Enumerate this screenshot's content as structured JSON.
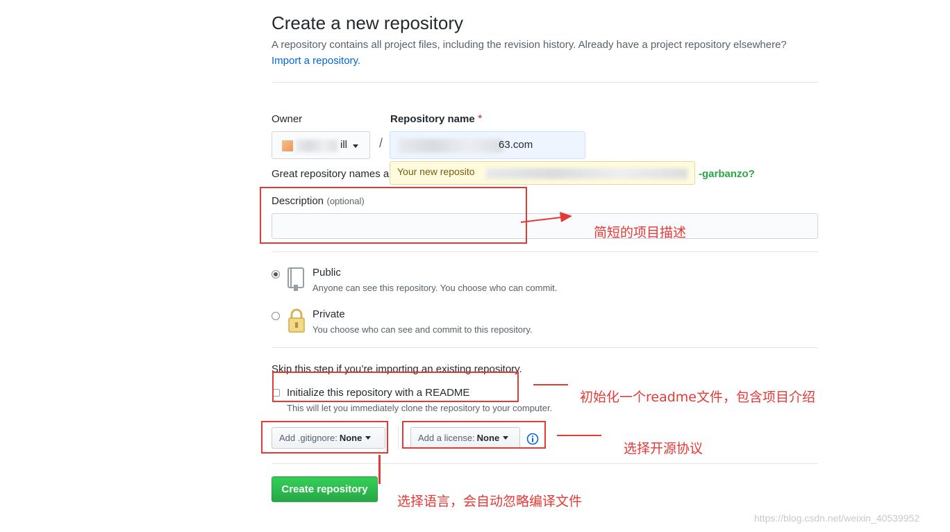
{
  "header": {
    "title": "Create a new repository",
    "subtitle": "A repository contains all project files, including the revision history. Already have a project repository elsewhere?",
    "import_link": "Import a repository."
  },
  "owner": {
    "label": "Owner",
    "value": "ill"
  },
  "repo": {
    "label": "Repository name",
    "required_mark": "*",
    "value": "63.com",
    "hint_prefix": "Great repository names a",
    "hint_suffix": "-garbanzo?",
    "tooltip": "Your new reposito"
  },
  "description": {
    "label": "Description",
    "optional": "(optional)",
    "value": ""
  },
  "visibility": {
    "selected": "public",
    "public": {
      "title": "Public",
      "desc": "Anyone can see this repository. You choose who can commit."
    },
    "private": {
      "title": "Private",
      "desc": "You choose who can see and commit to this repository."
    }
  },
  "init": {
    "skip_text": "Skip this step if you’re importing an existing repository.",
    "readme_label": "Initialize this repository with a README",
    "readme_desc": "This will let you immediately clone the repository to your computer.",
    "readme_checked": false
  },
  "gitignore": {
    "label": "Add .gitignore:",
    "value": "None"
  },
  "license": {
    "label": "Add a license:",
    "value": "None"
  },
  "submit": {
    "label": "Create repository"
  },
  "annotations": {
    "description": "简短的项目描述",
    "readme": "初始化一个readme文件，包含项目介绍",
    "license": "选择开源协议",
    "gitignore": "选择语言，会自动忽略编译文件"
  },
  "watermark": "https://blog.csdn.net/weixin_40539952",
  "colors": {
    "accent": "#0366d6",
    "green": "#2ea44f",
    "annotation_red": "#e53935"
  }
}
